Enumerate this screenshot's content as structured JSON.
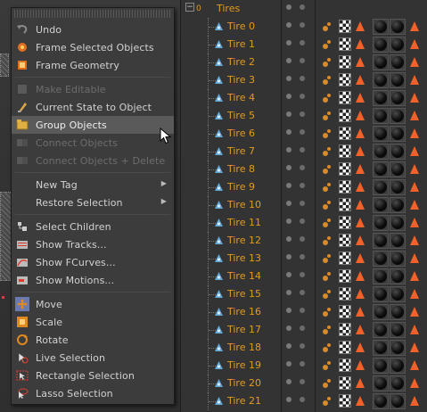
{
  "menu": {
    "items": [
      {
        "label": "Undo",
        "icon": "undo-icon",
        "disabled": false
      },
      {
        "label": "Frame Selected Objects",
        "icon": "frame-selected-icon",
        "disabled": false
      },
      {
        "label": "Frame Geometry",
        "icon": "frame-geometry-icon",
        "disabled": false
      },
      {
        "label": "Make Editable",
        "icon": "make-editable-icon",
        "disabled": true
      },
      {
        "label": "Current State to Object",
        "icon": "current-state-icon",
        "disabled": false
      },
      {
        "label": "Group Objects",
        "icon": "group-objects-icon",
        "disabled": false,
        "hover": true
      },
      {
        "label": "Connect Objects",
        "icon": "connect-objects-icon",
        "disabled": true
      },
      {
        "label": "Connect Objects + Delete",
        "icon": "connect-delete-icon",
        "disabled": true
      },
      {
        "label": "New Tag",
        "icon": "",
        "disabled": false,
        "submenu": true
      },
      {
        "label": "Restore Selection",
        "icon": "",
        "disabled": false,
        "submenu": true
      },
      {
        "label": "Select Children",
        "icon": "select-children-icon",
        "disabled": false
      },
      {
        "label": "Show Tracks...",
        "icon": "show-tracks-icon",
        "disabled": false
      },
      {
        "label": "Show FCurves...",
        "icon": "show-fcurves-icon",
        "disabled": false
      },
      {
        "label": "Show Motions...",
        "icon": "show-motions-icon",
        "disabled": false
      },
      {
        "label": "Move",
        "icon": "move-icon",
        "disabled": false
      },
      {
        "label": "Scale",
        "icon": "scale-icon",
        "disabled": false
      },
      {
        "label": "Rotate",
        "icon": "rotate-icon",
        "disabled": false
      },
      {
        "label": "Live Selection",
        "icon": "live-selection-icon",
        "disabled": false
      },
      {
        "label": "Rectangle Selection",
        "icon": "rectangle-selection-icon",
        "disabled": false
      },
      {
        "label": "Lasso Selection",
        "icon": "lasso-selection-icon",
        "disabled": false
      }
    ]
  },
  "object_manager": {
    "parent": {
      "name": "Tires",
      "expand_symbol": "−",
      "layer_index": "0"
    },
    "children": [
      "Tire 0",
      "Tire 1",
      "Tire 2",
      "Tire 3",
      "Tire 4",
      "Tire 5",
      "Tire 6",
      "Tire 7",
      "Tire 8",
      "Tire 9",
      "Tire 10",
      "Tire 11",
      "Tire 12",
      "Tire 13",
      "Tire 14",
      "Tire 15",
      "Tire 16",
      "Tire 17",
      "Tire 18",
      "Tire 19",
      "Tire 20",
      "Tire 21"
    ]
  },
  "colors": {
    "object_name": "#e19b22",
    "tag_triangle": "#f1622b",
    "menu_bg": "#3c3c3c",
    "menu_hover": "#5a5a5a"
  }
}
